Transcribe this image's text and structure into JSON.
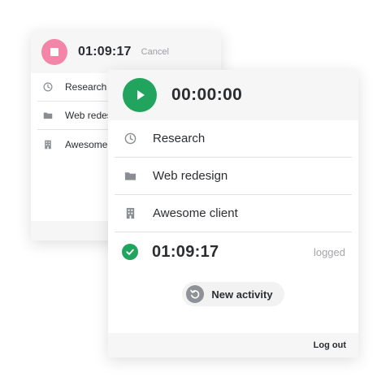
{
  "back_panel": {
    "timer": "01:09:17",
    "cancel_label": "Cancel",
    "items": [
      {
        "label": "Research",
        "icon": "clock-icon"
      },
      {
        "label": "Web redesign",
        "icon": "folder-icon"
      },
      {
        "label": "Awesome client",
        "icon": "building-icon"
      }
    ],
    "stop_color": "#f285a8"
  },
  "front_panel": {
    "timer": "00:00:00",
    "items": [
      {
        "label": "Research",
        "icon": "clock-icon"
      },
      {
        "label": "Web redesign",
        "icon": "folder-icon"
      },
      {
        "label": "Awesome client",
        "icon": "building-icon"
      }
    ],
    "logged_time": "01:09:17",
    "logged_label": "logged",
    "new_activity_label": "New activity",
    "logout_label": "Log out",
    "accent_color": "#21a45d"
  }
}
